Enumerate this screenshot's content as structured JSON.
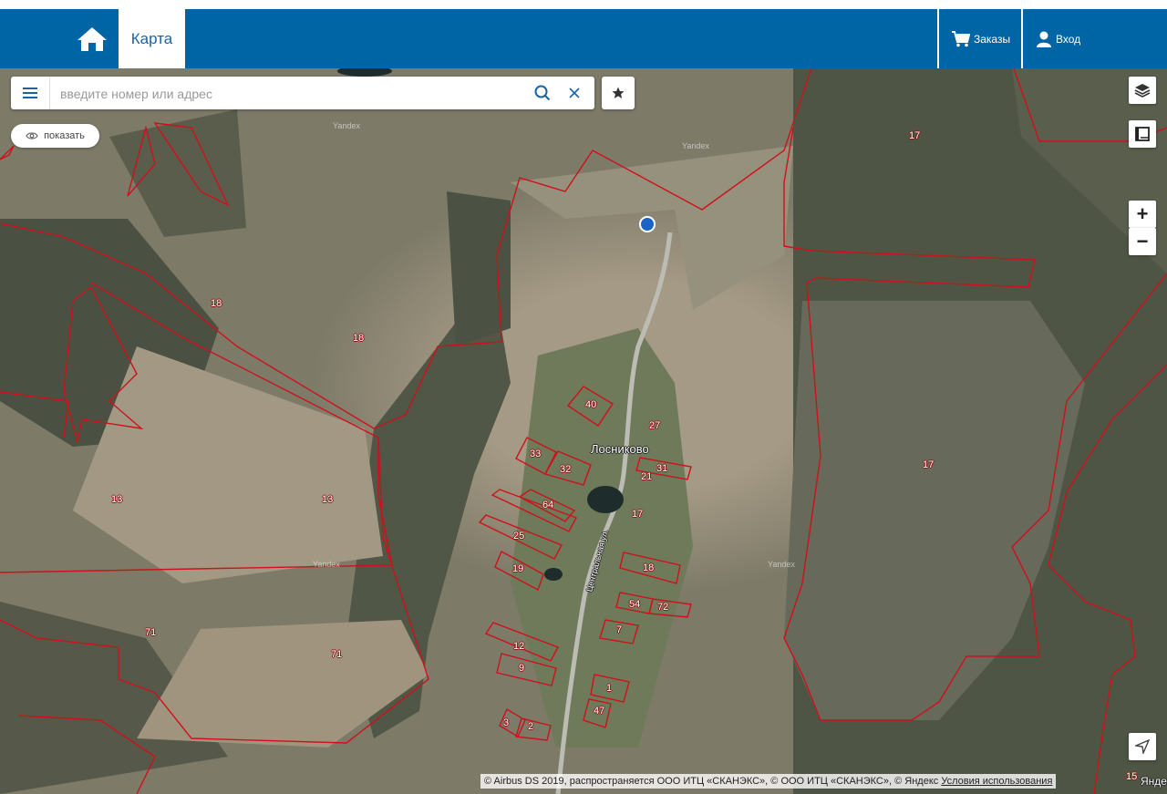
{
  "header": {
    "tab_label": "Карта",
    "orders_label": "Заказы",
    "login_label": "Вход"
  },
  "search": {
    "placeholder": "введите номер или адрес"
  },
  "show_toggle": {
    "label": "показать"
  },
  "zoom": {
    "in_label": "+",
    "out_label": "−"
  },
  "map": {
    "village_name": "Лосниково",
    "street_name": "Центральная ул.",
    "watermark": "Yandex",
    "parcel_labels": [
      "17",
      "18",
      "18",
      "13",
      "13",
      "71",
      "71",
      "17",
      "40",
      "33",
      "32",
      "64",
      "25",
      "19",
      "12",
      "9",
      "3",
      "2",
      "31",
      "27",
      "17",
      "18",
      "54",
      "72",
      "7",
      "1",
      "47",
      "21",
      "15"
    ],
    "attribution_text": "© Airbus DS 2019, распространяется ООО ИТЦ «СКАНЭКС», © ООО ИТЦ «СКАНЭКС», © Яндекс",
    "attribution_link": "Условия использования",
    "yandex_logo": "Яндекс"
  },
  "colors": {
    "header_bg": "#0065a4",
    "parcel_outline": "#d0101a",
    "location_dot": "#1a63c8"
  }
}
